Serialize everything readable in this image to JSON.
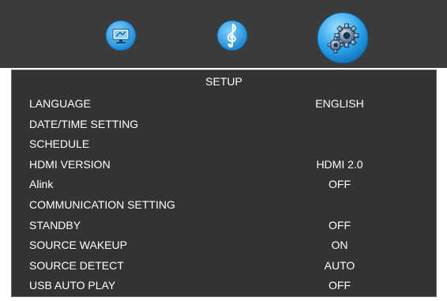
{
  "top_icons": {
    "display": {
      "name": "display-settings-icon"
    },
    "audio": {
      "name": "audio-settings-icon"
    },
    "setup": {
      "name": "setup-gear-icon",
      "selected": true
    }
  },
  "colors": {
    "topbar_bg": "#3b3b3b",
    "panel_bg": "#333333",
    "panel_border": "#6a6a6a",
    "text": "#ffffff",
    "icon_blue": "#2aa2ea"
  },
  "setup_menu": {
    "title": "SETUP",
    "items": [
      {
        "label": "LANGUAGE",
        "value": "ENGLISH"
      },
      {
        "label": "DATE/TIME SETTING",
        "value": ""
      },
      {
        "label": "SCHEDULE",
        "value": ""
      },
      {
        "label": "HDMI VERSION",
        "value": "HDMI 2.0"
      },
      {
        "label": "Alink",
        "value": "OFF"
      },
      {
        "label": "COMMUNICATION SETTING",
        "value": ""
      },
      {
        "label": "STANDBY",
        "value": "OFF"
      },
      {
        "label": "SOURCE WAKEUP",
        "value": "ON"
      },
      {
        "label": "SOURCE DETECT",
        "value": "AUTO"
      },
      {
        "label": "USB AUTO PLAY",
        "value": "OFF"
      }
    ]
  }
}
